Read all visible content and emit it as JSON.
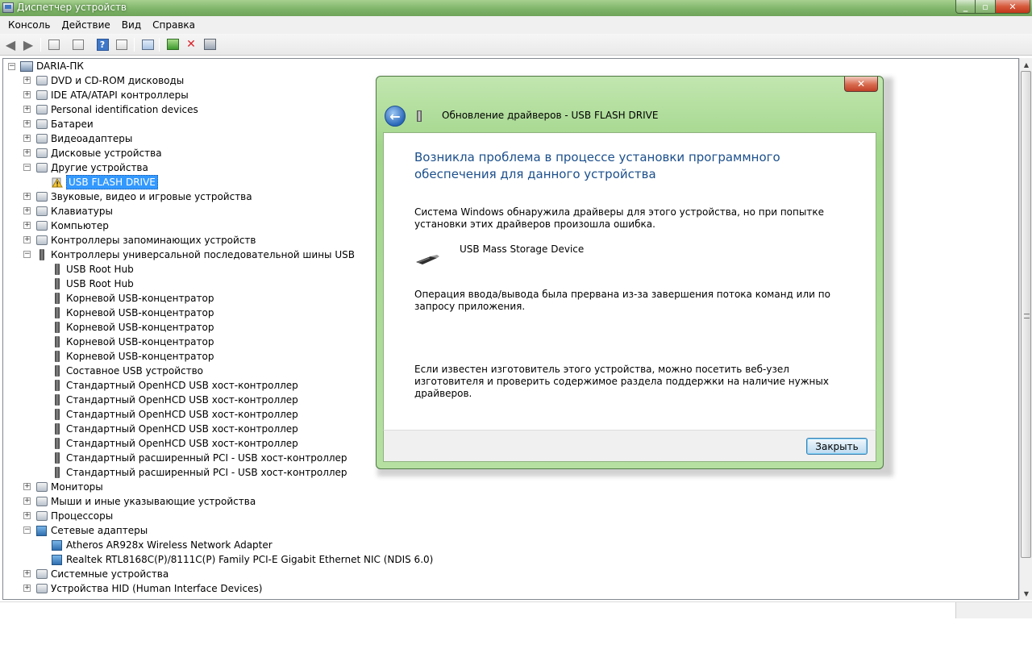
{
  "window": {
    "title": "Диспетчер устройств"
  },
  "menu": [
    "Консоль",
    "Действие",
    "Вид",
    "Справка"
  ],
  "toolbar": {
    "icons": [
      "back-arrow",
      "forward-arrow",
      "show-hide-console-tree",
      "properties",
      "help",
      "action-pane",
      "scan-hardware",
      "update-driver",
      "uninstall",
      "disable"
    ]
  },
  "tree": {
    "root": "DARIA-ПК",
    "rows": [
      {
        "label": "DVD и CD-ROM дисководы",
        "level": 1,
        "expander": "+",
        "icon": "cat"
      },
      {
        "label": "IDE ATA/ATAPI контроллеры",
        "level": 1,
        "expander": "+",
        "icon": "cat"
      },
      {
        "label": "Personal identification devices",
        "level": 1,
        "expander": "+",
        "icon": "cat"
      },
      {
        "label": "Батареи",
        "level": 1,
        "expander": "+",
        "icon": "cat"
      },
      {
        "label": "Видеоадаптеры",
        "level": 1,
        "expander": "+",
        "icon": "cat"
      },
      {
        "label": "Дисковые устройства",
        "level": 1,
        "expander": "+",
        "icon": "cat"
      },
      {
        "label": "Другие устройства",
        "level": 1,
        "expander": "-",
        "icon": "cat"
      },
      {
        "label": "USB FLASH DRIVE",
        "level": 2,
        "expander": "",
        "icon": "warn",
        "selected": true
      },
      {
        "label": "Звуковые, видео и игровые устройства",
        "level": 1,
        "expander": "+",
        "icon": "cat"
      },
      {
        "label": "Клавиатуры",
        "level": 1,
        "expander": "+",
        "icon": "cat"
      },
      {
        "label": "Компьютер",
        "level": 1,
        "expander": "+",
        "icon": "cat"
      },
      {
        "label": "Контроллеры запоминающих устройств",
        "level": 1,
        "expander": "+",
        "icon": "cat"
      },
      {
        "label": "Контроллеры универсальной последовательной шины USB",
        "level": 1,
        "expander": "-",
        "icon": "usb"
      },
      {
        "label": "USB Root Hub",
        "level": 2,
        "expander": "",
        "icon": "usb"
      },
      {
        "label": "USB Root Hub",
        "level": 2,
        "expander": "",
        "icon": "usb"
      },
      {
        "label": "Корневой USB-концентратор",
        "level": 2,
        "expander": "",
        "icon": "usb"
      },
      {
        "label": "Корневой USB-концентратор",
        "level": 2,
        "expander": "",
        "icon": "usb"
      },
      {
        "label": "Корневой USB-концентратор",
        "level": 2,
        "expander": "",
        "icon": "usb"
      },
      {
        "label": "Корневой USB-концентратор",
        "level": 2,
        "expander": "",
        "icon": "usb"
      },
      {
        "label": "Корневой USB-концентратор",
        "level": 2,
        "expander": "",
        "icon": "usb"
      },
      {
        "label": "Составное USB устройство",
        "level": 2,
        "expander": "",
        "icon": "usb"
      },
      {
        "label": "Стандартный OpenHCD USB хост-контроллер",
        "level": 2,
        "expander": "",
        "icon": "usb"
      },
      {
        "label": "Стандартный OpenHCD USB хост-контроллер",
        "level": 2,
        "expander": "",
        "icon": "usb"
      },
      {
        "label": "Стандартный OpenHCD USB хост-контроллер",
        "level": 2,
        "expander": "",
        "icon": "usb"
      },
      {
        "label": "Стандартный OpenHCD USB хост-контроллер",
        "level": 2,
        "expander": "",
        "icon": "usb"
      },
      {
        "label": "Стандартный OpenHCD USB хост-контроллер",
        "level": 2,
        "expander": "",
        "icon": "usb"
      },
      {
        "label": "Стандартный расширенный PCI - USB хост-контроллер",
        "level": 2,
        "expander": "",
        "icon": "usb"
      },
      {
        "label": "Стандартный расширенный PCI - USB хост-контроллер",
        "level": 2,
        "expander": "",
        "icon": "usb"
      },
      {
        "label": "Мониторы",
        "level": 1,
        "expander": "+",
        "icon": "cat"
      },
      {
        "label": "Мыши и иные указывающие устройства",
        "level": 1,
        "expander": "+",
        "icon": "cat"
      },
      {
        "label": "Процессоры",
        "level": 1,
        "expander": "+",
        "icon": "cat"
      },
      {
        "label": "Сетевые адаптеры",
        "level": 1,
        "expander": "-",
        "icon": "net"
      },
      {
        "label": "Atheros AR928x Wireless Network Adapter",
        "level": 2,
        "expander": "",
        "icon": "net"
      },
      {
        "label": "Realtek RTL8168C(P)/8111C(P) Family PCI-E Gigabit Ethernet NIC (NDIS 6.0)",
        "level": 2,
        "expander": "",
        "icon": "net"
      },
      {
        "label": "Системные устройства",
        "level": 1,
        "expander": "+",
        "icon": "cat"
      },
      {
        "label": "Устройства HID (Human Interface Devices)",
        "level": 1,
        "expander": "+",
        "icon": "cat"
      }
    ]
  },
  "dialog": {
    "title": "Обновление драйверов - USB FLASH DRIVE",
    "heading": "Возникла проблема в процессе установки программного обеспечения для данного устройства",
    "p1": "Система Windows обнаружила драйверы для этого устройства, но при попытке установки этих драйверов произошла ошибка.",
    "device": "USB Mass Storage Device",
    "p2": "Операция ввода/вывода была прервана из-за завершения потока команд или по запросу приложения.",
    "p3": "Если известен изготовитель этого устройства, можно посетить веб-узел изготовителя и проверить содержимое раздела поддержки на наличие нужных драйверов.",
    "close_button": "Закрыть"
  }
}
